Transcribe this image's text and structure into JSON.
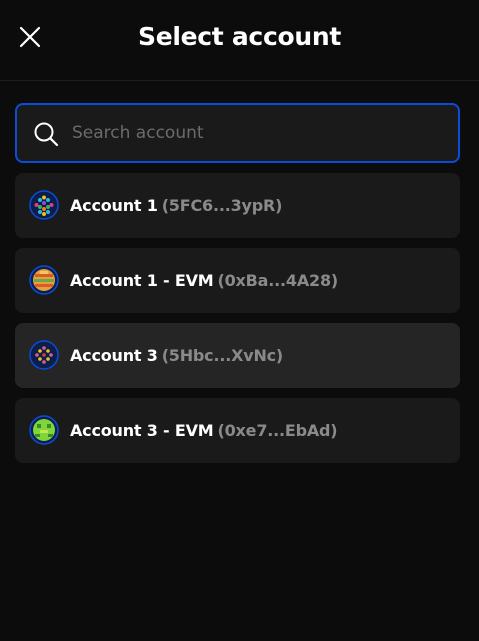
{
  "header": {
    "title": "Select account",
    "close_icon": "close-icon"
  },
  "search": {
    "placeholder": "Search account",
    "value": "",
    "icon": "search-icon"
  },
  "accounts": [
    {
      "name": "Account 1",
      "address": "(5FC6...3ypR)",
      "avatar": "polkadot-identicon",
      "selected": false
    },
    {
      "name": "Account 1 - EVM",
      "address": "(0xBa...4A28)",
      "avatar": "evm-identicon",
      "selected": false
    },
    {
      "name": "Account 3",
      "address": "(5Hbc...XvNc)",
      "avatar": "polkadot-identicon",
      "selected": true
    },
    {
      "name": "Account 3 - EVM",
      "address": "(0xe7...EbAd)",
      "avatar": "evm-identicon",
      "selected": false
    }
  ],
  "colors": {
    "background": "#0c0c0c",
    "card": "#1a1a1a",
    "card_selected": "#252525",
    "accent": "#0b4cda",
    "muted_text": "#8a8a8a"
  }
}
